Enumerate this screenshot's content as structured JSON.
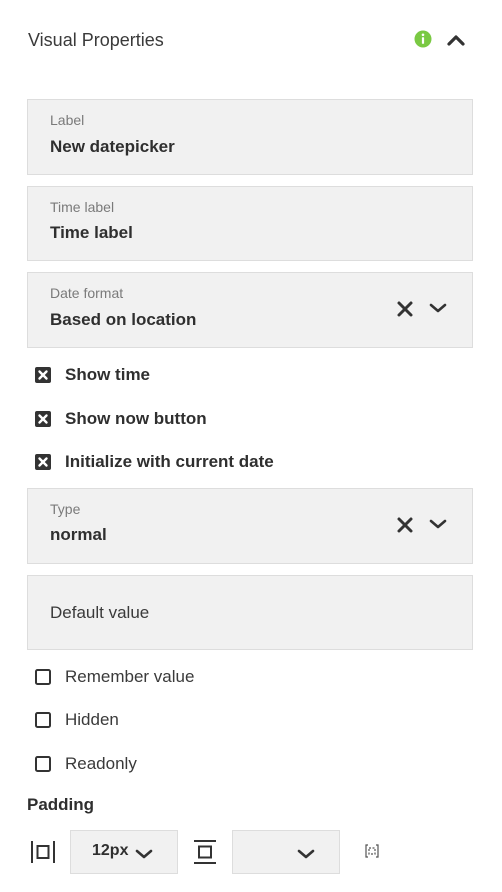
{
  "header": {
    "title": "Visual Properties"
  },
  "fields": {
    "label": {
      "label": "Label",
      "value": "New datepicker"
    },
    "time_label": {
      "label": "Time label",
      "value": "Time label"
    },
    "date_format": {
      "label": "Date format",
      "value": "Based on location"
    },
    "type": {
      "label": "Type",
      "value": "normal"
    },
    "default_value": {
      "placeholder": "Default value"
    }
  },
  "checkboxes": {
    "show_time": {
      "label": "Show time",
      "checked": true
    },
    "show_now_button": {
      "label": "Show now button",
      "checked": true
    },
    "initialize_current_date": {
      "label": "Initialize with current date",
      "checked": true
    },
    "remember_value": {
      "label": "Remember value",
      "checked": false
    },
    "hidden": {
      "label": "Hidden",
      "checked": false
    },
    "readonly": {
      "label": "Readonly",
      "checked": false
    }
  },
  "padding": {
    "title": "Padding",
    "horizontal_value": "12px",
    "vertical_value": ""
  },
  "colors": {
    "info": "#7ac943",
    "field_bg": "#f1f1f1",
    "text": "#2f2f2f"
  },
  "icons": [
    "info-icon",
    "chevron-up-icon",
    "close-icon",
    "chevron-down-icon",
    "checkbox-checked-icon",
    "checkbox-unchecked-icon",
    "padding-horizontal-icon",
    "padding-vertical-icon",
    "link-icon"
  ]
}
